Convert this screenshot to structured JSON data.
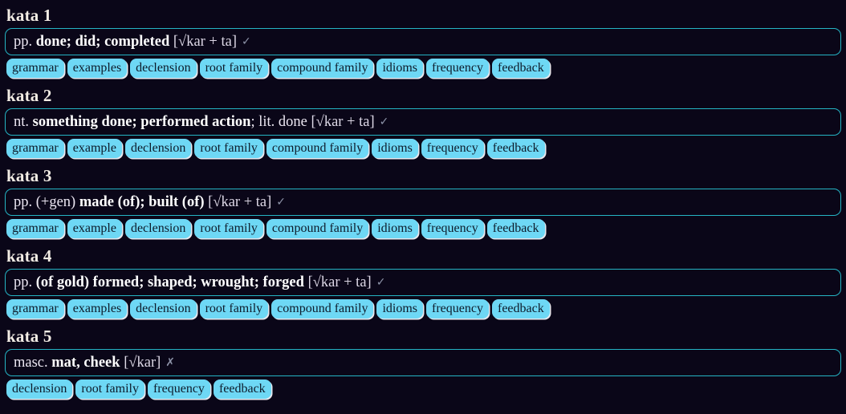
{
  "entries": [
    {
      "title": "kata 1",
      "definition": {
        "pos": "pp.",
        "meaning": "done; did; completed",
        "extra": "",
        "root": "[√kar + ta]",
        "mark": "✓",
        "mark_name": "check-icon"
      },
      "badges": [
        "grammar",
        "examples",
        "declension",
        "root family",
        "compound family",
        "idioms",
        "frequency",
        "feedback"
      ]
    },
    {
      "title": "kata 2",
      "definition": {
        "pos": "nt.",
        "meaning": "something done; performed action",
        "extra": "; lit. done",
        "root": "[√kar + ta]",
        "mark": "✓",
        "mark_name": "check-icon"
      },
      "badges": [
        "grammar",
        "example",
        "declension",
        "root family",
        "compound family",
        "idioms",
        "frequency",
        "feedback"
      ]
    },
    {
      "title": "kata 3",
      "definition": {
        "pos": "pp. (+gen)",
        "meaning": "made (of); built (of)",
        "extra": "",
        "root": "[√kar + ta]",
        "mark": "✓",
        "mark_name": "check-icon"
      },
      "badges": [
        "grammar",
        "example",
        "declension",
        "root family",
        "compound family",
        "idioms",
        "frequency",
        "feedback"
      ]
    },
    {
      "title": "kata 4",
      "definition": {
        "pos": "pp.",
        "meaning": "(of gold) formed; shaped; wrought; forged",
        "extra": "",
        "root": "[√kar + ta]",
        "mark": "✓",
        "mark_name": "check-icon"
      },
      "badges": [
        "grammar",
        "examples",
        "declension",
        "root family",
        "compound family",
        "idioms",
        "frequency",
        "feedback"
      ]
    },
    {
      "title": "kata 5",
      "definition": {
        "pos": "masc.",
        "meaning": "mat, cheek",
        "extra": "",
        "root": "[√kar]",
        "mark": "✗",
        "mark_name": "cross-icon"
      },
      "badges": [
        "declension",
        "root family",
        "frequency",
        "feedback"
      ]
    }
  ],
  "colors": {
    "background": "#0a0618",
    "box_border": "#25b4c4",
    "badge_background": "#6ed8f5",
    "badge_text": "#0d1b2a",
    "heading_text": "#f2ece4",
    "definition_text": "#ece7f2",
    "mark": "#8d93a8"
  }
}
